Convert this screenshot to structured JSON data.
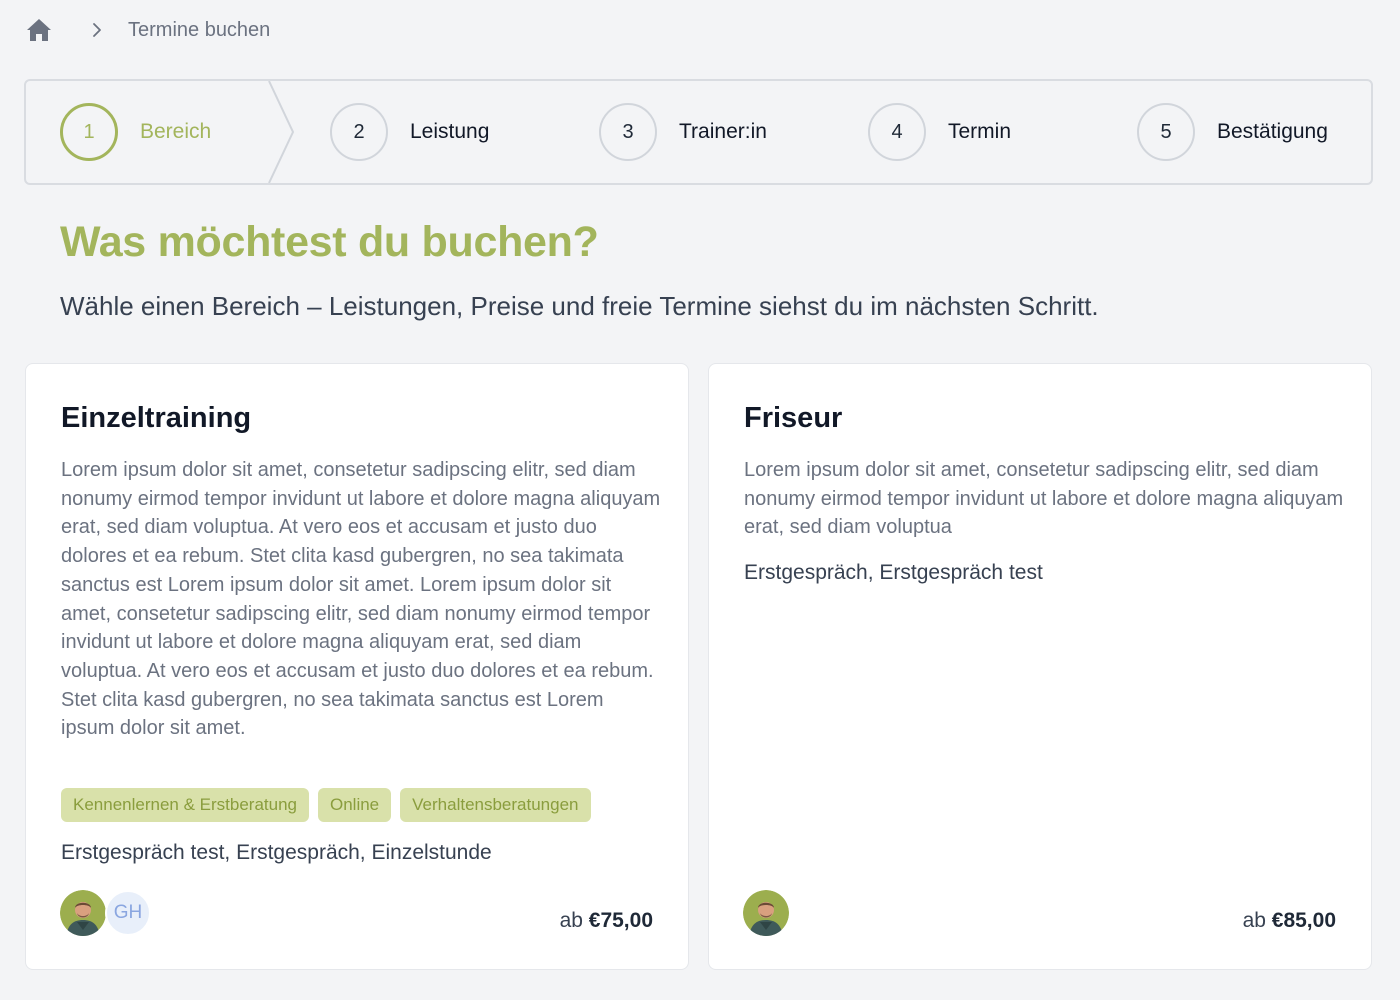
{
  "breadcrumb": {
    "home_icon": "home-icon",
    "separator_icon": "chevron-right-icon",
    "current": "Termine buchen"
  },
  "stepper": {
    "steps": [
      {
        "number": "1",
        "label": "Bereich",
        "active": true
      },
      {
        "number": "2",
        "label": "Leistung",
        "active": false
      },
      {
        "number": "3",
        "label": "Trainer:in",
        "active": false
      },
      {
        "number": "4",
        "label": "Termin",
        "active": false
      },
      {
        "number": "5",
        "label": "Bestätigung",
        "active": false
      }
    ]
  },
  "page": {
    "title": "Was möchtest du buchen?",
    "subtitle": "Wähle einen Bereich – Leistungen, Preise und freie Termine siehst du im nächsten Schritt."
  },
  "cards": [
    {
      "title": "Einzeltraining",
      "description": "Lorem ipsum dolor sit amet, consetetur sadipscing elitr, sed diam nonumy eirmod tempor invidunt ut labore et dolore magna aliquyam erat, sed diam voluptua. At vero eos et accusam et justo duo dolores et ea rebum. Stet clita kasd gubergren, no sea takimata sanctus est Lorem ipsum dolor sit amet. Lorem ipsum dolor sit amet, consetetur sadipscing elitr, sed diam nonumy eirmod tempor invidunt ut labore et dolore magna aliquyam erat, sed diam voluptua. At vero eos et accusam et justo duo dolores et ea rebum. Stet clita kasd gubergren, no sea takimata sanctus est Lorem ipsum dolor sit amet.",
      "tags": [
        "Kennenlernen & Erstberatung",
        "Online",
        "Verhaltensberatungen"
      ],
      "services": "Erstgespräch test, Erstgespräch, Einzelstunde",
      "avatar_initials": "GH",
      "price_prefix": "ab",
      "price": "€75,00"
    },
    {
      "title": "Friseur",
      "description": "Lorem ipsum dolor sit amet, consetetur sadipscing elitr, sed diam nonumy eirmod tempor invidunt ut labore et dolore magna aliquyam erat, sed diam voluptua",
      "services": "Erstgespräch, Erstgespräch test",
      "price_prefix": "ab",
      "price": "€85,00"
    }
  ],
  "colors": {
    "accent": "#a3b55c",
    "tag_bg": "#d9e1aa",
    "tag_text": "#8a9d3d",
    "background": "#f3f4f6",
    "card_bg": "#ffffff"
  }
}
